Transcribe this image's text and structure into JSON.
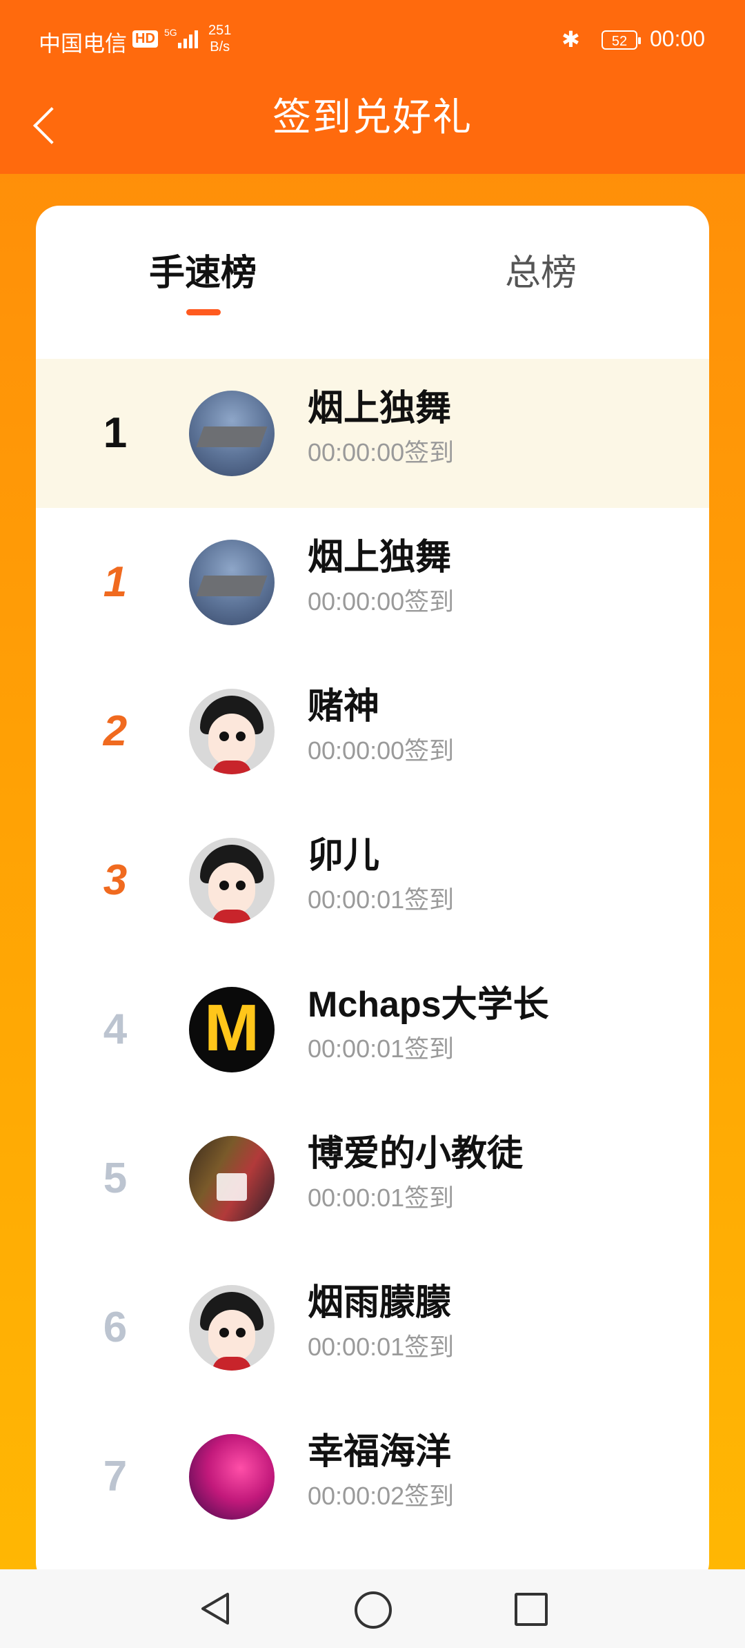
{
  "status_bar": {
    "carrier": "中国电信",
    "hd_badge": "HD",
    "network": "5G",
    "net_speed_value": "251",
    "net_speed_unit": "B/s",
    "battery": "52",
    "time": "00:00"
  },
  "header": {
    "title": "签到兑好礼"
  },
  "tabs": [
    {
      "label": "手速榜",
      "active": true
    },
    {
      "label": "总榜",
      "active": false
    }
  ],
  "rows": [
    {
      "rank": "1",
      "name": "烟上独舞",
      "time": "00:00:00签到",
      "avatar": "carrier-avatar",
      "self": true
    },
    {
      "rank": "1",
      "name": "烟上独舞",
      "time": "00:00:00签到",
      "avatar": "carrier-avatar"
    },
    {
      "rank": "2",
      "name": "赌神",
      "time": "00:00:00签到",
      "avatar": "cartoon-avatar"
    },
    {
      "rank": "3",
      "name": "卯儿",
      "time": "00:00:01签到",
      "avatar": "cartoon-avatar"
    },
    {
      "rank": "4",
      "name": "Mchaps大学长",
      "time": "00:00:01签到",
      "avatar": "m-logo-avatar"
    },
    {
      "rank": "5",
      "name": "博爱的小教徒",
      "time": "00:00:01签到",
      "avatar": "players-avatar"
    },
    {
      "rank": "6",
      "name": "烟雨朦朦",
      "time": "00:00:01签到",
      "avatar": "cartoon-avatar"
    },
    {
      "rank": "7",
      "name": "幸福海洋",
      "time": "00:00:02签到",
      "avatar": "neon-avatar"
    }
  ],
  "m_logo_text": "M",
  "colors": {
    "header_bg": "#FF6A0D",
    "accent": "#FF5A1F",
    "medal_rank": "#F06A1F",
    "grey_rank": "#BCC4D0",
    "self_row_bg": "#FCF7E6"
  }
}
